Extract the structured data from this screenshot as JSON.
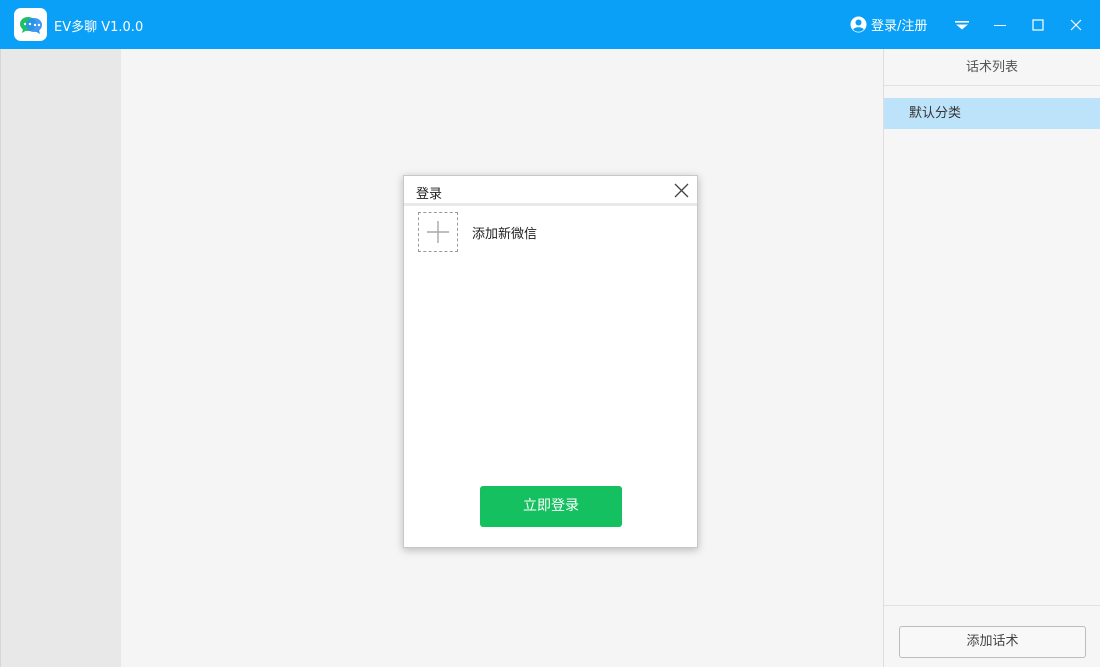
{
  "app": {
    "title": "EV多聊  V1.0.0",
    "login_label": "登录/注册",
    "icons": {
      "logo": "chat-bubbles-logo-icon",
      "user": "user-circle-icon",
      "menu": "dropdown-menu-icon",
      "minimize": "minimize-icon",
      "maximize": "maximize-icon",
      "close": "close-icon"
    }
  },
  "right_panel": {
    "title": "话术列表",
    "categories": [
      {
        "label": "默认分类",
        "selected": true
      }
    ],
    "add_button_label": "添加话术"
  },
  "dialog": {
    "title": "登录",
    "add_wechat_label": "添加新微信",
    "login_button_label": "立即登录"
  },
  "colors": {
    "titlebar": "#0aa0f7",
    "selected_category": "#bde3fb",
    "login_button": "#15c060"
  }
}
